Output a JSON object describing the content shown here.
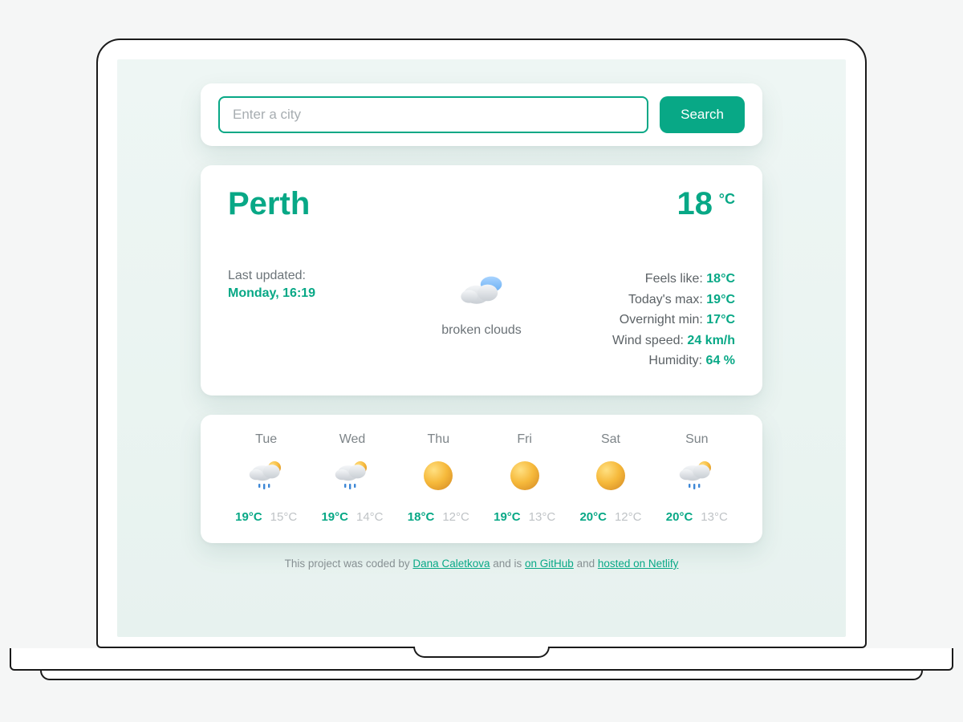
{
  "colors": {
    "accent": "#08a886"
  },
  "search": {
    "placeholder": "Enter a city",
    "button": "Search"
  },
  "current": {
    "city": "Perth",
    "temp": "18",
    "unit": "°C",
    "last_updated_label": "Last updated:",
    "last_updated_value": "Monday, 16:19",
    "condition": "broken clouds",
    "icon": "broken-clouds",
    "stats": {
      "feels_like_label": "Feels like: ",
      "feels_like_value": "18°C",
      "max_label": "Today's max: ",
      "max_value": "19°C",
      "min_label": "Overnight min: ",
      "min_value": "17°C",
      "wind_label": "Wind speed: ",
      "wind_value": "24 km/h",
      "humidity_label": "Humidity: ",
      "humidity_value": "64 %"
    }
  },
  "forecast": [
    {
      "day": "Tue",
      "icon": "rain-sun",
      "hi": "19°C",
      "lo": "15°C"
    },
    {
      "day": "Wed",
      "icon": "rain-sun",
      "hi": "19°C",
      "lo": "14°C"
    },
    {
      "day": "Thu",
      "icon": "sun",
      "hi": "18°C",
      "lo": "12°C"
    },
    {
      "day": "Fri",
      "icon": "sun",
      "hi": "19°C",
      "lo": "13°C"
    },
    {
      "day": "Sat",
      "icon": "sun",
      "hi": "20°C",
      "lo": "12°C"
    },
    {
      "day": "Sun",
      "icon": "rain-sun",
      "hi": "20°C",
      "lo": "13°C"
    }
  ],
  "footer": {
    "pre": "This project was coded by ",
    "author": "Dana Caletkova",
    "mid": " and is ",
    "github": "on GitHub",
    "and": " and ",
    "netlify": "hosted on Netlify"
  }
}
